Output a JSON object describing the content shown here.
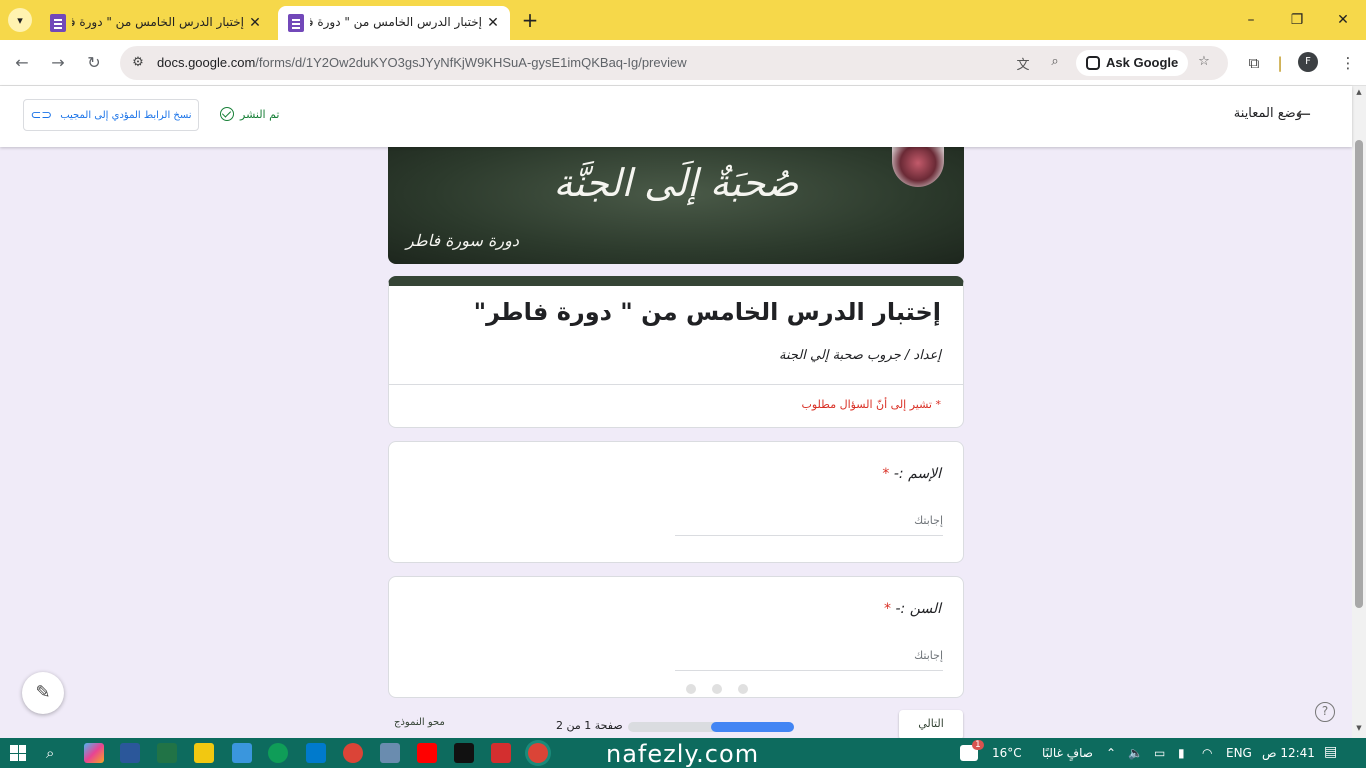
{
  "browser": {
    "tabs": [
      {
        "title": "إختبار الدرس الخامس من \" دورة فا",
        "active": false
      },
      {
        "title": "إختبار الدرس الخامس من \" دورة فا",
        "active": true
      }
    ],
    "new_tab_label": "+",
    "window_controls": {
      "minimize": "–",
      "restore": "❐",
      "close": "✕"
    },
    "url_host": "docs.google.com",
    "url_path": "/forms/d/1Y2Ow2duKYO3gsJYyNfKjW9KHSuA-gysE1imQKBaq-Ig/preview",
    "ask_google_label": "Ask Google",
    "profile_initial": "F"
  },
  "preview_header": {
    "copy_link_label": "نسخ الرابط المؤدي إلى المجيب",
    "published_label": "تم النشر",
    "preview_mode_label": "وضع المعاينة"
  },
  "banner": {
    "title": "صُحبَةٌ إلَى الجنَّة",
    "subtitle": "دورة سورة فاطر"
  },
  "form": {
    "title": "إختبار الدرس الخامس من \" دورة فاطر\"",
    "description": "إعداد / جروب صحبة إلي الجنة",
    "required_note": "* تشير إلى أنّ السؤال مطلوب",
    "questions": [
      {
        "label": "الإسم :-",
        "required_mark": "*",
        "placeholder": "إجابتك"
      },
      {
        "label": "السن :-",
        "required_mark": "*",
        "placeholder": "إجابتك"
      }
    ],
    "next_label": "التالي",
    "page_indicator": "صفحة 1 من 2",
    "progress_fraction": 0.5,
    "clear_form_label": "محو النموذج"
  },
  "watermark": "nafezly.com",
  "taskbar": {
    "temperature": "16°C",
    "weather": "صافٍ غالبًا",
    "language": "ENG",
    "time": "12:41 ص",
    "notification_badge": "1"
  },
  "colors": {
    "tab_strip": "#f6d84a",
    "form_accent": "#354435",
    "required_red": "#d93025",
    "link_blue": "#1a73e8",
    "published_green": "#188038",
    "taskbar": "#0d6b5e",
    "form_background": "#f0ebf8"
  }
}
